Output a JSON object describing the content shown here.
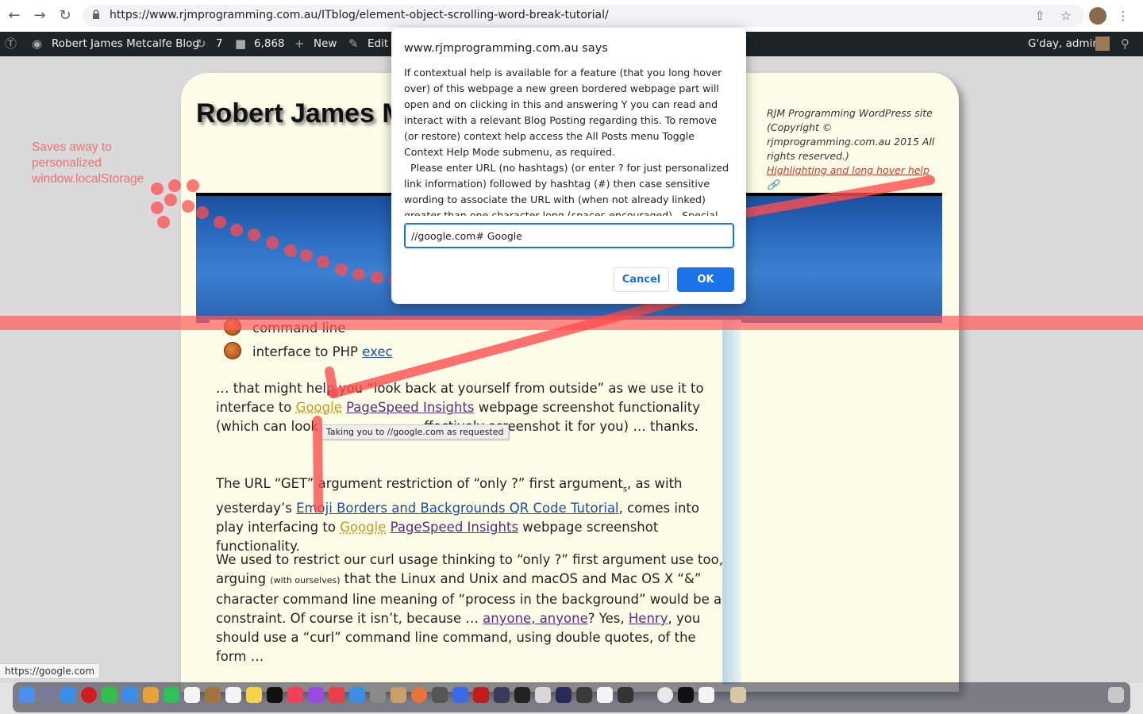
{
  "browser": {
    "url": "https://www.rjmprogramming.com.au/ITblog/element-object-scrolling-word-break-tutorial/",
    "icons": [
      "back-icon",
      "forward-icon",
      "reload-icon",
      "lock-icon",
      "share-icon",
      "star-icon",
      "menu-icon"
    ]
  },
  "adminbar": {
    "site_name": "Robert James Metcalfe Blog",
    "updates_count": "7",
    "comments_count": "6,868",
    "new_label": "New",
    "edit_label": "Edit P",
    "greeting": "G'day, admin"
  },
  "site": {
    "title": "Robert James M",
    "sidebar_copy": "RJM Programming WordPress site (Copyright © rjmprogramming.com.au 2015 All rights reserved.)",
    "sidebar_link": "Highlighting and long hover help"
  },
  "content": {
    "list_item_1": "command line",
    "list_item_2_prefix": "interface to PHP ",
    "list_item_2_link": "exec",
    "p1": {
      "a": "… that might help you “look back at yourself from outside” as we use it to interface to ",
      "google": "Google",
      "link": "PageSpeed Insights",
      "b": " webpage screenshot functionality (which can look ",
      "c": "ffectively screenshot it for you) … thanks."
    },
    "p2": {
      "a": "The URL “GET” argument restriction of “only ?” first argument",
      "sub": "s",
      "b": ", as with yesterday’s ",
      "link": "Emoji Borders and Backgrounds QR Code Tutorial",
      "c": ", comes into play interfacing to ",
      "google": "Google",
      "link2": "PageSpeed Insights",
      "d": " webpage screenshot functionality."
    },
    "p3": {
      "a": "We used to restrict our curl usage thinking to “only ?” first argument use too, arguing ",
      "small": "(with ourselves)",
      "b": " that the Linux and Unix and macOS and Mac OS X “&” character command line meaning of “process in the background” would be a constraint.  Of course it isn’t, because … ",
      "link1": "anyone, anyone",
      "c": "? Yes, ",
      "link2": "Henry",
      "d": ", you should use a “curl” command line command, using double quotes, of the form …"
    },
    "tooltip": "Taking you to //google.com as requested"
  },
  "annotation": {
    "line1": "Saves away to",
    "line2": "personalized",
    "line3": "window.localStorage"
  },
  "dialog": {
    "title": "www.rjmprogramming.com.au says",
    "body_1": "If contextual help is available for a feature (that you long hover over) of this webpage a new green bordered webpage part will open and on clicking in this and answering Y you can read and interact with a relevant Blog Posting regarding this.  To remove (or restore) context help access the All Posts menu Toggle Context Help Mode submenu, as required.",
    "body_2": "  Please enter URL (no hashtags) (or enter ? for just personalized link information) followed by hashtag (#) then case sensitive wording to associate the URL with (when not already linked) greater than one character long (spaces encouraged).  Special URL",
    "input_value": "//google.com# Google",
    "cancel_label": "Cancel",
    "ok_label": "OK"
  },
  "statusbar": {
    "url": "https://google.com"
  },
  "colors": {
    "accent": "#1a73e8",
    "overlay_red": "#ff5a5a",
    "annotation": "#f07070"
  }
}
